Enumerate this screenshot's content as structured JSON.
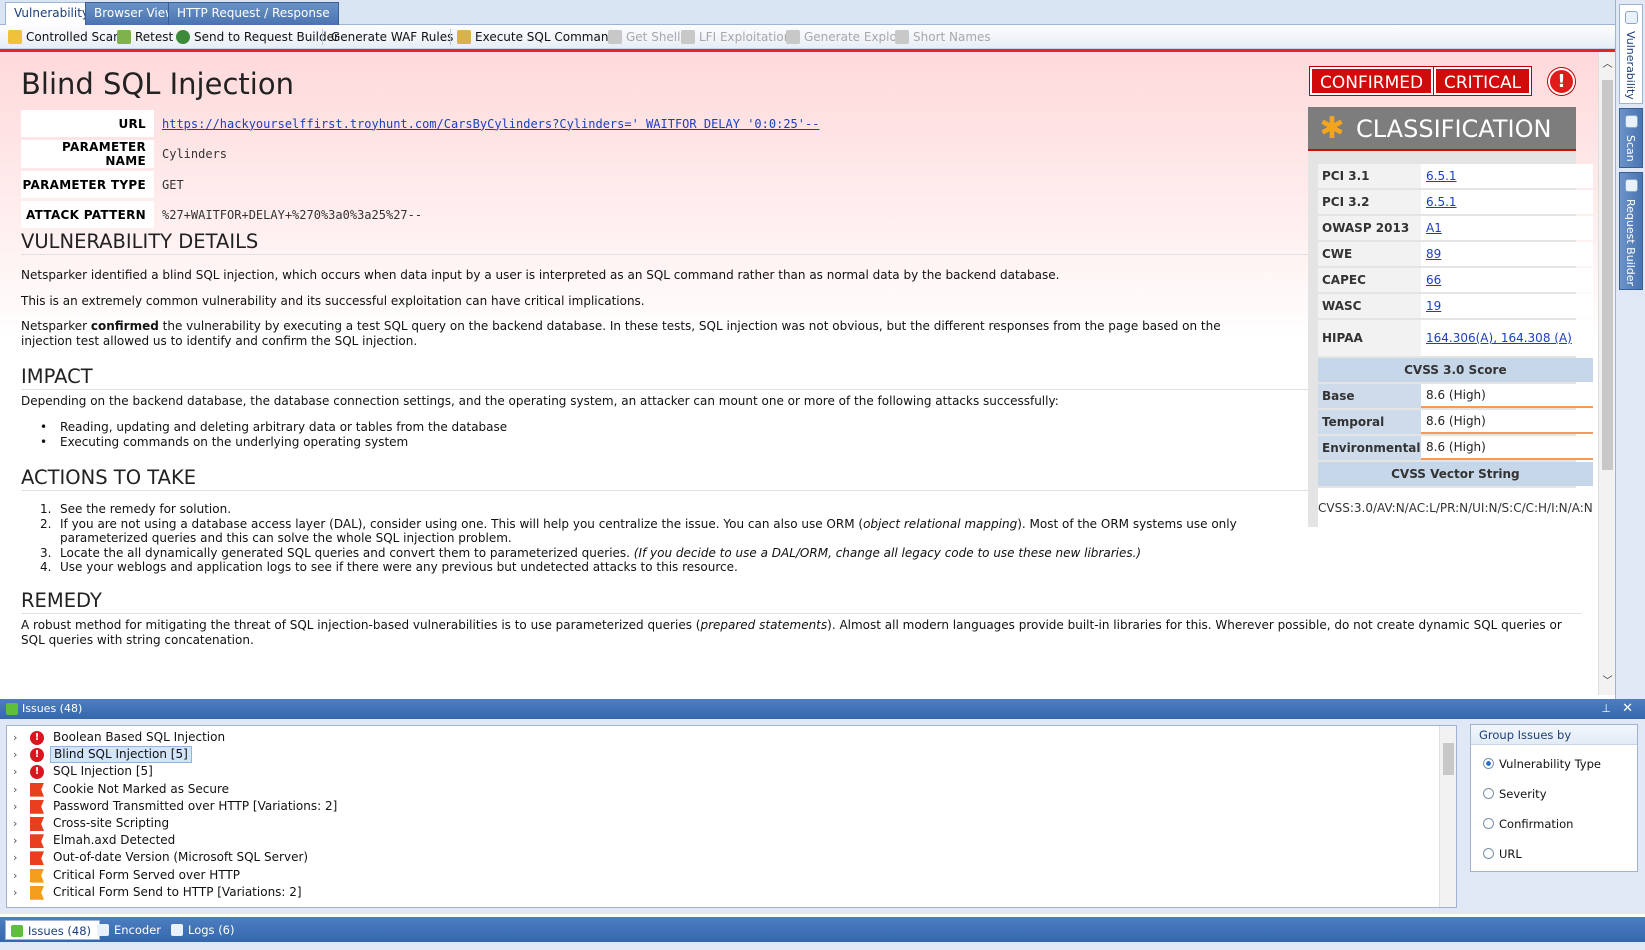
{
  "tabs": [
    "Vulnerability",
    "Browser View",
    "HTTP Request / Response"
  ],
  "toolbar": {
    "controlled_scan": "Controlled Scan",
    "retest": "Retest",
    "send_to_request_builder": "Send to Request Builder",
    "generate_waf_rules": "Generate WAF Rules",
    "execute_sql": "Execute SQL Commands",
    "get_shell": "Get Shell",
    "lfi": "LFI Exploitation",
    "generate_exploit": "Generate Exploit",
    "short_names": "Short Names"
  },
  "side_tabs": [
    "Vulnerability",
    "Scan",
    "Request Builder"
  ],
  "vuln": {
    "title": "Blind SQL Injection",
    "badge_confirmed": "CONFIRMED",
    "badge_critical": "CRITICAL",
    "url_label": "URL",
    "url": "https://hackyourselffirst.troyhunt.com/CarsByCylinders?Cylinders=' WAITFOR DELAY '0:0:25'--",
    "param_name_label": "PARAMETER NAME",
    "param_name": "Cylinders",
    "param_type_label": "PARAMETER TYPE",
    "param_type": "GET",
    "attack_label": "ATTACK PATTERN",
    "attack": "%27+WAITFOR+DELAY+%270%3a0%3a25%27--"
  },
  "details": {
    "heading": "VULNERABILITY DETAILS",
    "p1": "Netsparker identified a blind SQL injection, which occurs when data input by a user is interpreted as an SQL command rather than as normal data by the backend database.",
    "p2": "This is an extremely common vulnerability and its successful exploitation can have critical implications.",
    "p3_pre": "Netsparker ",
    "p3_bold": "confirmed",
    "p3_post": " the vulnerability by executing a test SQL query on the backend database. In these tests, SQL injection was not obvious, but the different responses from the page based on the injection test allowed us to identify and confirm the SQL injection."
  },
  "impact": {
    "heading": "IMPACT",
    "intro": "Depending on the backend database, the database connection settings, and the operating system, an attacker can mount one or more of the following attacks successfully:",
    "items": [
      "Reading, updating and deleting arbitrary data or tables from the database",
      "Executing commands on the underlying operating system"
    ]
  },
  "actions": {
    "heading": "ACTIONS TO TAKE",
    "i1": "See the remedy for solution.",
    "i2_pre": "If you are not using a database access layer (DAL), consider using one. This will help you centralize the issue. You can also use ORM (",
    "i2_em": "object relational mapping",
    "i2_post": "). Most of the ORM systems use only parameterized queries and this can solve the whole SQL injection problem.",
    "i3_pre": "Locate the all dynamically generated SQL queries and convert them to parameterized queries. ",
    "i3_em": "(If you decide to use a DAL/ORM, change all legacy code to use these new libraries.)",
    "i4": "Use your weblogs and application logs to see if there were any previous but undetected attacks to this resource."
  },
  "remedy": {
    "heading": "REMEDY",
    "pre": "A robust method for mitigating the threat of SQL injection-based vulnerabilities is to use parameterized queries (",
    "em": "prepared statements",
    "post": "). Almost all modern languages provide built-in libraries for this. Wherever possible, do not create dynamic SQL queries or SQL queries with string concatenation."
  },
  "classification": {
    "heading": "CLASSIFICATION",
    "rows": [
      {
        "k": "PCI 3.1",
        "v": "6.5.1"
      },
      {
        "k": "PCI 3.2",
        "v": "6.5.1"
      },
      {
        "k": "OWASP 2013",
        "v": "A1"
      },
      {
        "k": "CWE",
        "v": "89"
      },
      {
        "k": "CAPEC",
        "v": "66"
      },
      {
        "k": "WASC",
        "v": "19"
      },
      {
        "k": "HIPAA",
        "v": "164.306(A), 164.308 (A)"
      }
    ],
    "cvss_heading": "CVSS 3.0 Score",
    "cvss": [
      {
        "k": "Base",
        "v": "8.6 (High)"
      },
      {
        "k": "Temporal",
        "v": "8.6 (High)"
      },
      {
        "k": "Environmental",
        "v": "8.6 (High)"
      }
    ],
    "vector_heading": "CVSS Vector String",
    "vector": "CVSS:3.0/AV:N/AC:L/PR:N/UI:N/S:C/C:H/I:N/A:N"
  },
  "issues": {
    "title": "Issues (48)",
    "rows": [
      {
        "label": "Boolean Based SQL Injection",
        "sev": "crit"
      },
      {
        "label": "Blind SQL Injection [5]",
        "sev": "crit"
      },
      {
        "label": "SQL Injection [5]",
        "sev": "crit"
      },
      {
        "label": "Cookie Not Marked as Secure",
        "sev": "high"
      },
      {
        "label": "Password Transmitted over HTTP [Variations: 2]",
        "sev": "high"
      },
      {
        "label": "Cross-site Scripting",
        "sev": "high"
      },
      {
        "label": "Elmah.axd Detected",
        "sev": "high"
      },
      {
        "label": "Out-of-date Version (Microsoft SQL Server)",
        "sev": "high"
      },
      {
        "label": "Critical Form Served over HTTP",
        "sev": "med"
      },
      {
        "label": "Critical Form Send to HTTP [Variations: 2]",
        "sev": "med"
      }
    ],
    "group_heading": "Group Issues by",
    "group_options": [
      "Vulnerability Type",
      "Severity",
      "Confirmation",
      "URL"
    ]
  },
  "bottom_tabs": [
    "Issues (48)",
    "Encoder",
    "Logs (6)"
  ]
}
